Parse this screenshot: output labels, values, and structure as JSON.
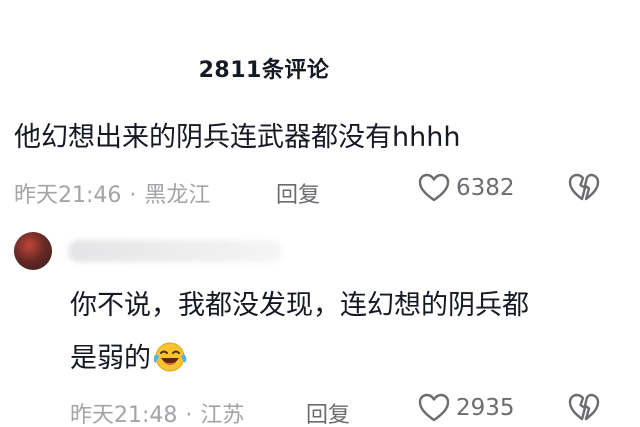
{
  "header": {
    "title": "2811条评论"
  },
  "comments": [
    {
      "text": "他幻想出来的阴兵连武器都没有hhhh",
      "time": "昨天21:46",
      "separator": "·",
      "location": "黑龙江",
      "reply_label": "回复",
      "likes": "6382"
    },
    {
      "text_line1": "你不说，我都没发现，连幻想的阴兵都",
      "text_line2": "是弱的",
      "emoji": "laughing-crying-emoji",
      "time": "昨天21:48",
      "separator": "·",
      "location": "江苏",
      "reply_label": "回复",
      "likes": "2935"
    }
  ]
}
